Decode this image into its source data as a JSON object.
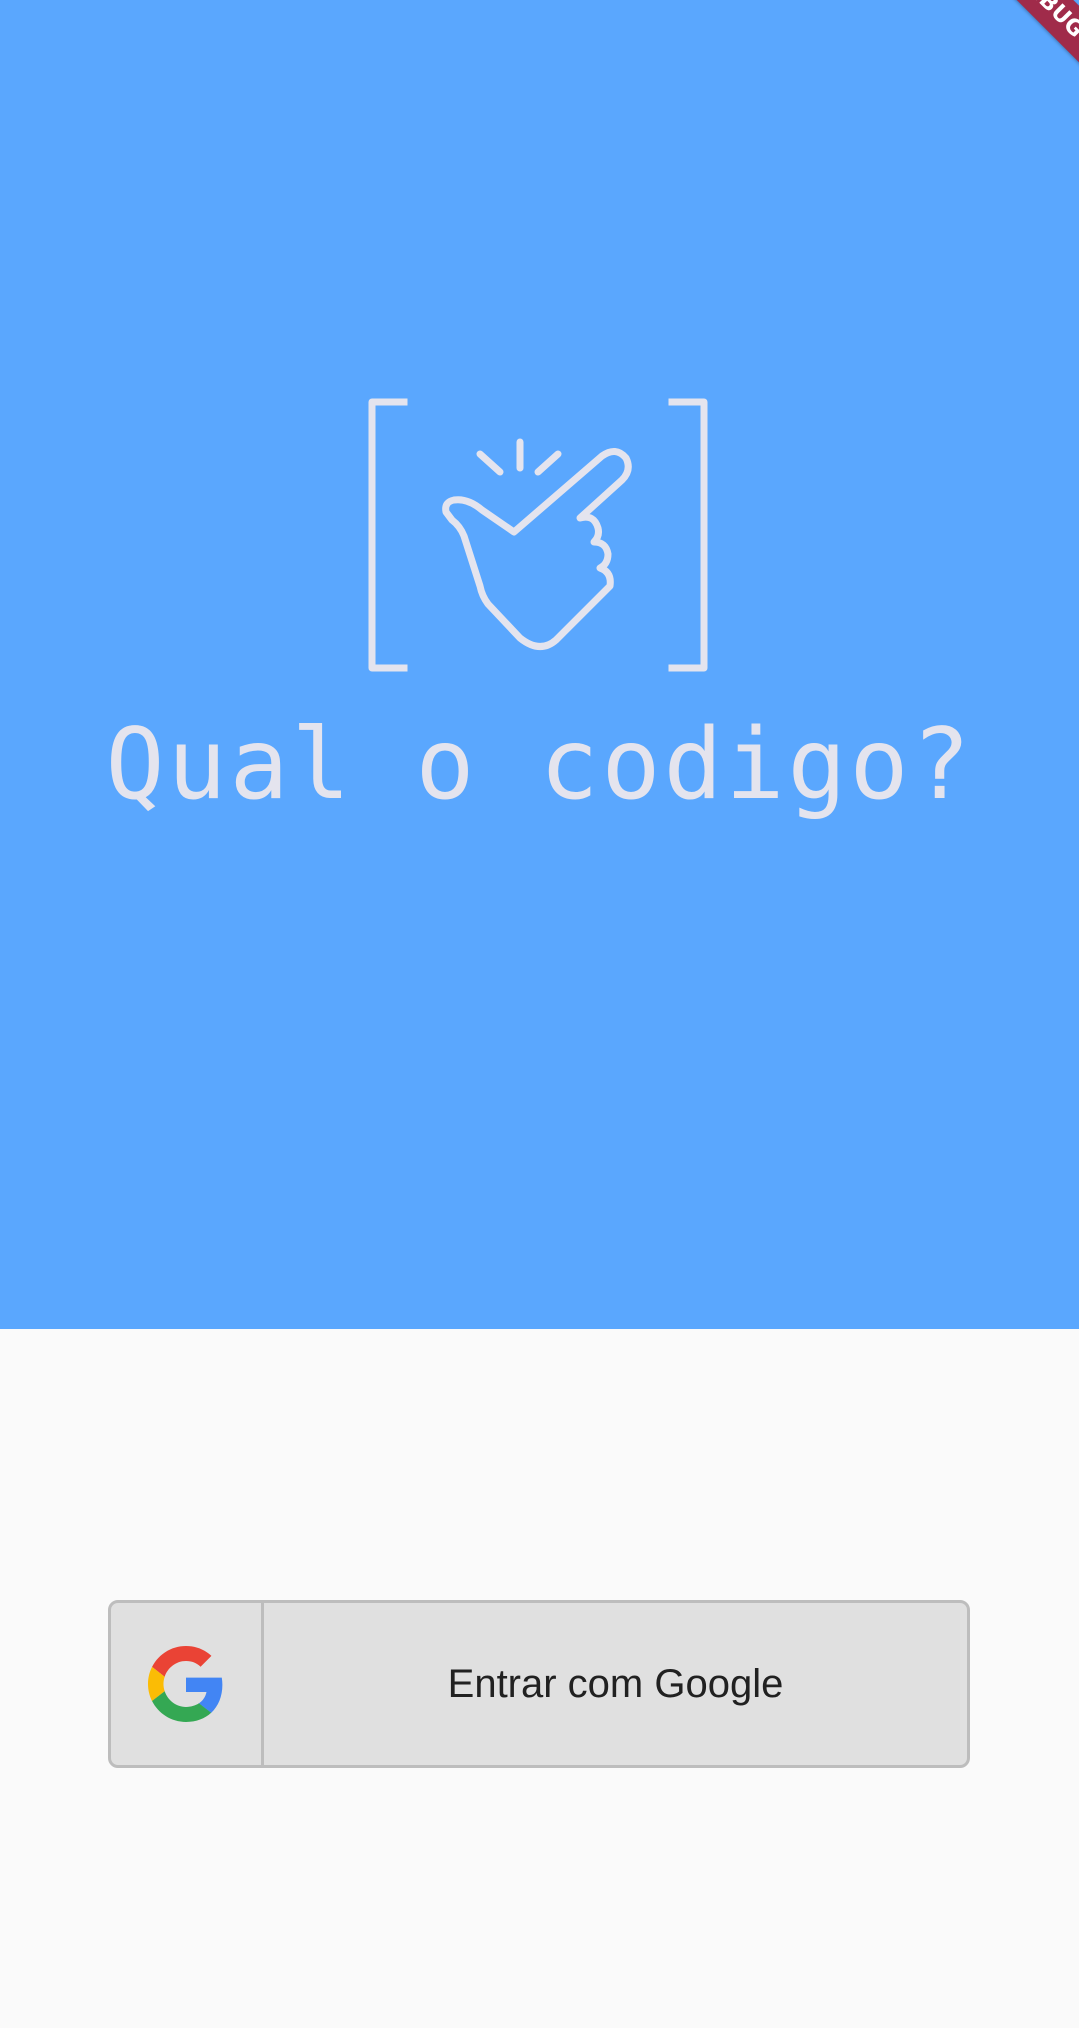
{
  "hero": {
    "title": "Qual o codigo?",
    "background_color": "#5aa7fe",
    "text_color": "#e4e4ee",
    "logo_icon": "bracketed-tapping-hand-icon"
  },
  "auth": {
    "signin_label": "Entrar com Google",
    "provider_icon": "google-g-icon"
  },
  "debug_banner": {
    "label": "DEBUG"
  }
}
